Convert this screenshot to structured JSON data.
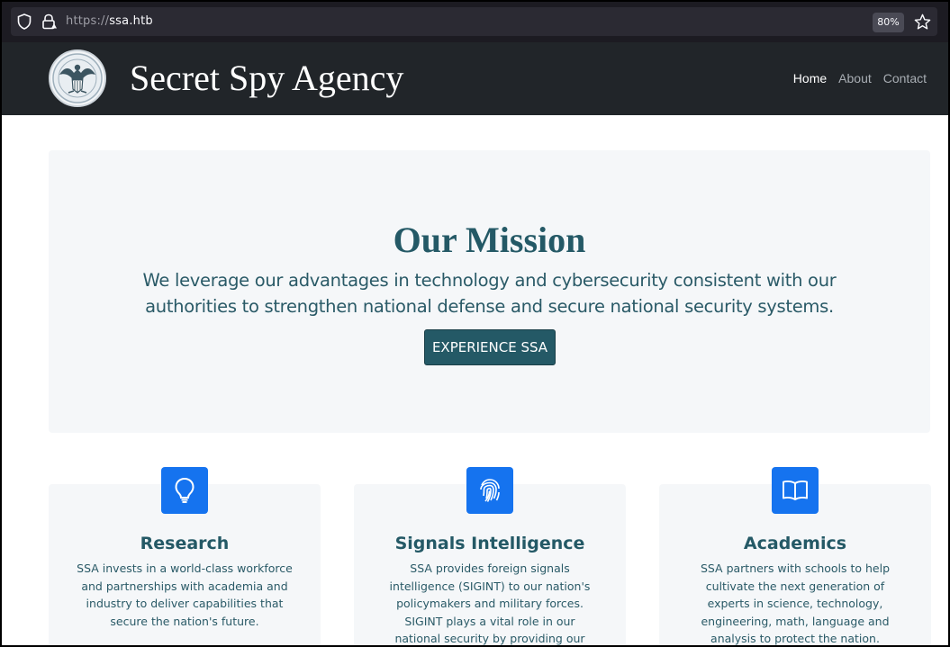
{
  "browser": {
    "url_scheme": "https://",
    "url_host": "ssa.htb",
    "zoom": "80%"
  },
  "nav": {
    "brand": "Secret Spy Agency",
    "links": [
      "Home",
      "About",
      "Contact"
    ],
    "active": "Home"
  },
  "hero": {
    "title": "Our Mission",
    "text": "We leverage our advantages in technology and cybersecurity consistent with our authorities to strengthen national defense and secure national security systems.",
    "button": "EXPERIENCE SSA"
  },
  "features": [
    {
      "icon": "lightbulb-icon",
      "title": "Research",
      "text": "SSA invests in a world-class workforce and partnerships with academia and industry to deliver capabilities that secure the nation's future."
    },
    {
      "icon": "fingerprint-icon",
      "title": "Signals Intelligence",
      "text": "SSA provides foreign signals intelligence (SIGINT) to our nation's policymakers and military forces. SIGINT plays a vital role in our national security by providing our"
    },
    {
      "icon": "book-icon",
      "title": "Academics",
      "text": "SSA partners with schools to help cultivate the next generation of experts in science, technology, engineering, math, language and analysis to protect the nation."
    }
  ],
  "colors": {
    "accent": "#245966",
    "icon_bg": "#1573ef",
    "navbar": "#212529",
    "panel": "#f5f7f9"
  }
}
